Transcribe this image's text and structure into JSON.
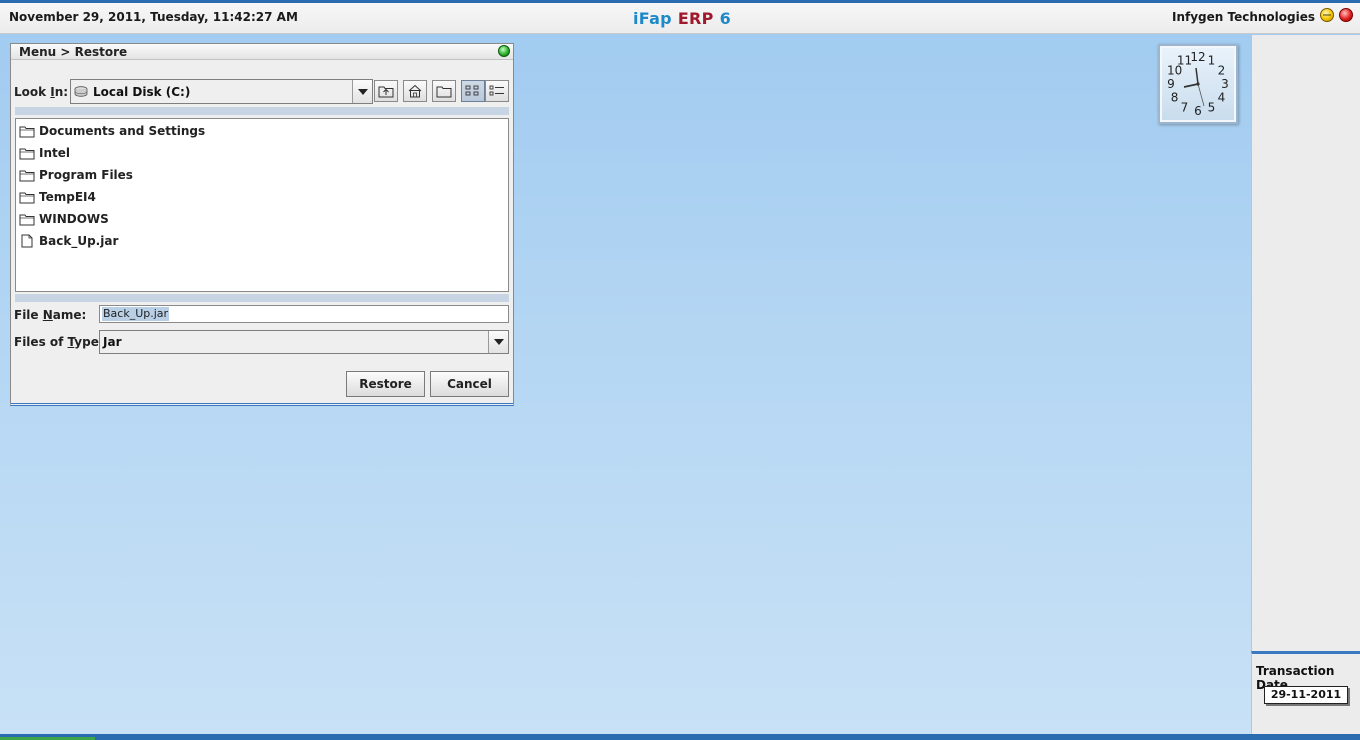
{
  "header": {
    "datetime": "November  29, 2011, Tuesday, 11:42:27 AM",
    "title_part1": "iFap",
    "title_part2": "ERP",
    "title_part3": "6",
    "company": "Infygen Technologies"
  },
  "dialog": {
    "breadcrumb": "Menu > Restore",
    "look_in_label_pre": "Look ",
    "look_in_label_mnemonic": "I",
    "look_in_label_post": "n:",
    "look_in_value": "Local Disk (C:)",
    "files": [
      {
        "name": "Documents and Settings",
        "icon": "folder-icon"
      },
      {
        "name": "Intel",
        "icon": "folder-icon"
      },
      {
        "name": "Program Files",
        "icon": "folder-icon"
      },
      {
        "name": "TempEI4",
        "icon": "folder-icon"
      },
      {
        "name": "WINDOWS",
        "icon": "folder-icon"
      },
      {
        "name": "Back_Up.jar",
        "icon": "file-icon"
      }
    ],
    "file_name_label_pre": "File ",
    "file_name_label_mnemonic": "N",
    "file_name_label_post": "ame:",
    "file_name_value": "Back_Up.jar",
    "files_of_type_label_pre": "Files of ",
    "files_of_type_label_mnemonic": "T",
    "files_of_type_label_post": "ype:",
    "files_of_type_value": "Jar",
    "restore_label": "Restore",
    "cancel_label": "Cancel"
  },
  "right_panel": {
    "transaction_label": "Transaction Date",
    "transaction_date": "29-11-2011"
  },
  "clock": {
    "numbers": [
      "12",
      "1",
      "2",
      "3",
      "4",
      "5",
      "6",
      "7",
      "8",
      "9",
      "10",
      "11"
    ]
  },
  "colors": {
    "accent": "#2b6cb0",
    "title_blue": "#1f89c8",
    "title_red": "#a0182b"
  }
}
